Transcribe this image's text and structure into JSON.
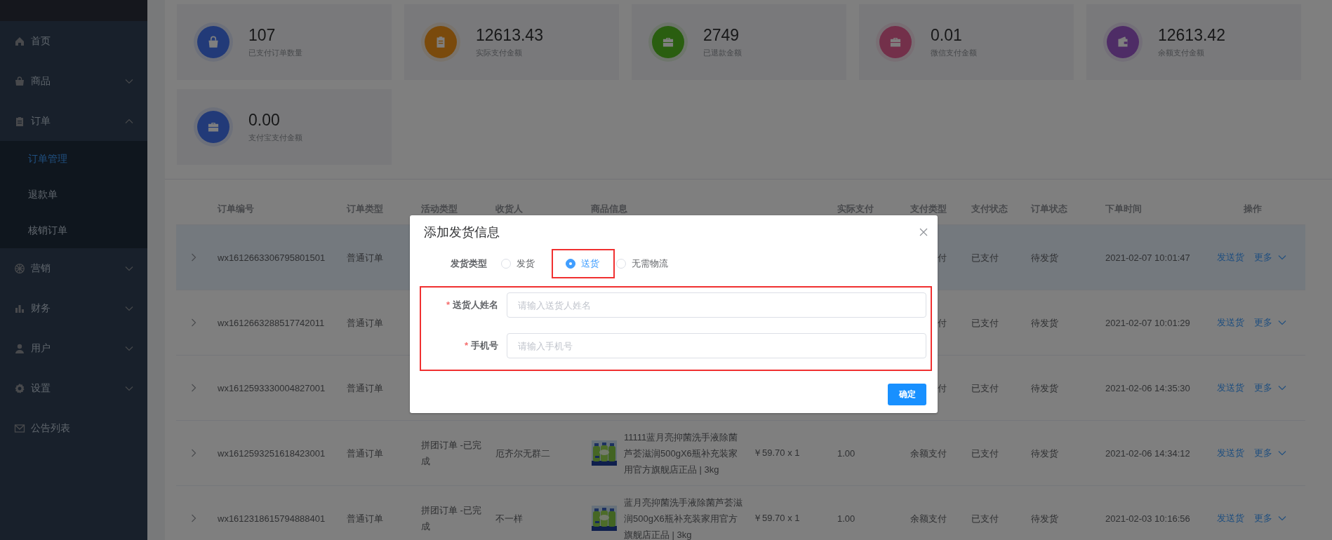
{
  "sidebar": {
    "items": [
      {
        "label": "首页"
      },
      {
        "label": "商品",
        "expanded": false
      },
      {
        "label": "订单",
        "expanded": true,
        "children": [
          {
            "label": "订单管理",
            "selected": true
          },
          {
            "label": "退款单",
            "selected": false
          },
          {
            "label": "核销订单",
            "selected": false
          }
        ]
      },
      {
        "label": "营销",
        "expanded": false
      },
      {
        "label": "财务",
        "expanded": false
      },
      {
        "label": "用户",
        "expanded": false
      },
      {
        "label": "设置",
        "expanded": false
      },
      {
        "label": "公告列表"
      }
    ]
  },
  "stats": [
    {
      "value": "107",
      "label": "已支付订单数量",
      "color": "#223a78"
    },
    {
      "value": "12613.43",
      "label": "实际支付金额",
      "color": "#7a4a0c"
    },
    {
      "value": "2749",
      "label": "已退款金额",
      "color": "#2a5e10"
    },
    {
      "value": "0.01",
      "label": "微信支付金额",
      "color": "#73304a"
    },
    {
      "value": "12613.42",
      "label": "余额支付金额",
      "color": "#4e2c66"
    },
    {
      "value": "0.00",
      "label": "支付宝支付金额",
      "color": "#223a78"
    }
  ],
  "table": {
    "columns": [
      "订单编号",
      "订单类型",
      "活动类型",
      "收货人",
      "商品信息",
      "实际支付",
      "支付类型",
      "支付状态",
      "订单状态",
      "下单时间",
      "操作"
    ],
    "rows": [
      {
        "highlighted": true,
        "order_no": "wx1612663306795801501",
        "order_type": "普通订单",
        "pay_type": "付",
        "pay_type_partial": true,
        "pay_status": "已支付",
        "order_status": "待发货",
        "time": "2021-02-07 10:01:47",
        "send": "发送货",
        "more": "更多"
      },
      {
        "highlighted": false,
        "order_no": "wx1612663288517742011",
        "order_type": "普通订单",
        "pay_type": "付",
        "pay_type_partial": true,
        "pay_status": "已支付",
        "order_status": "待发货",
        "time": "2021-02-07 10:01:29",
        "send": "发送货",
        "more": "更多"
      },
      {
        "highlighted": false,
        "order_no": "wx1612593330004827001",
        "order_type": "普通订单",
        "pay_type": "付",
        "pay_type_partial": true,
        "pay_status": "已支付",
        "order_status": "待发货",
        "time": "2021-02-06 14:35:30",
        "send": "发送货",
        "more": "更多"
      },
      {
        "highlighted": false,
        "order_no": "wx1612593251618423001",
        "order_type": "普通订单",
        "activity": "拼团订单 -已完成",
        "receiver": "厄齐尔无群二",
        "goods": {
          "kind": "picture",
          "name": "11111蓝月亮抑菌洗手液除菌芦荟滋润500gX6瓶补充装家用官方旗舰店正品 | 3kg",
          "price": "￥59.70 x 1"
        },
        "paid": "1.00",
        "pay_type": "余额支付",
        "pay_type_partial": false,
        "pay_status": "已支付",
        "order_status": "待发货",
        "time": "2021-02-06 14:34:12",
        "send": "发送货",
        "more": "更多"
      },
      {
        "highlighted": false,
        "order_no": "wx1612318615794888401",
        "order_type": "普通订单",
        "activity": "拼团订单 -已完成",
        "receiver": "不一样",
        "goods": {
          "kind": "picture",
          "name": "蓝月亮抑菌洗手液除菌芦荟滋润500gX6瓶补充装家用官方旗舰店正品 | 3kg",
          "price": "￥59.70 x 1"
        },
        "paid": "1.00",
        "pay_type": "余额支付",
        "pay_type_partial": false,
        "pay_status": "已支付",
        "order_status": "待发货",
        "time": "2021-02-03 10:16:56",
        "send": "发送货",
        "more": "更多"
      }
    ]
  },
  "dialog": {
    "title": "添加发货信息",
    "type_label": "发货类型",
    "options": [
      {
        "label": "发货",
        "selected": false,
        "marked": false
      },
      {
        "label": "送货",
        "selected": true,
        "marked": true
      },
      {
        "label": "无需物流",
        "selected": false,
        "marked": false
      }
    ],
    "fields_marked": true,
    "fields": [
      {
        "required_mark": "*",
        "label": "送货人姓名",
        "placeholder": "请输入送货人姓名"
      },
      {
        "required_mark": "*",
        "label": "手机号",
        "placeholder": "请输入手机号"
      }
    ],
    "confirm": "确定"
  }
}
